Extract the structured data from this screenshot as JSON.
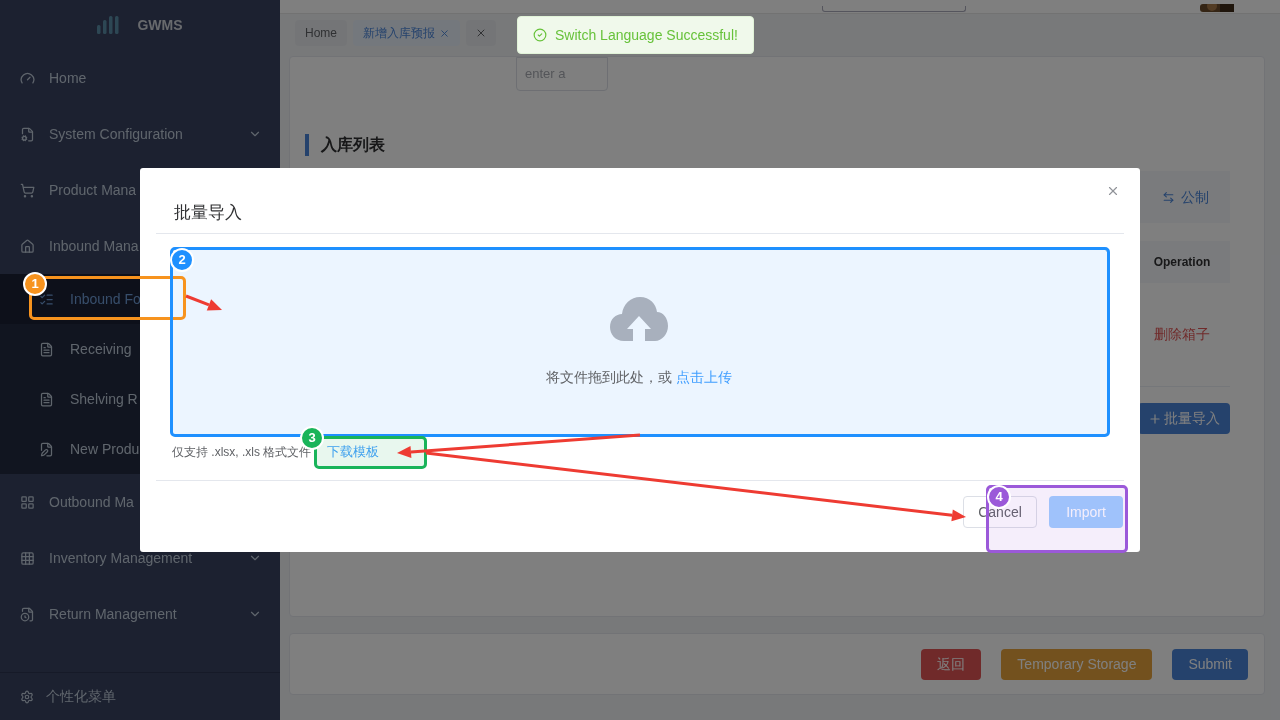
{
  "sidebar": {
    "logo": "GWMS",
    "items": [
      {
        "label": "Home",
        "kind": "link"
      },
      {
        "label": "System Configuration",
        "kind": "menu"
      },
      {
        "label": "Product Mana",
        "kind": "link"
      },
      {
        "label": "Inbound Mana",
        "kind": "link",
        "children": [
          {
            "label": "Inbound Fo",
            "selected": true
          },
          {
            "label": "Receiving",
            "selected": false
          },
          {
            "label": "Shelving R",
            "selected": false
          },
          {
            "label": "New Produ",
            "selected": false
          }
        ]
      },
      {
        "label": "Outbound Ma",
        "kind": "link"
      },
      {
        "label": "Inventory Management",
        "kind": "menu"
      },
      {
        "label": "Return Management",
        "kind": "menu"
      }
    ],
    "footer": "个性化菜单"
  },
  "tabs": [
    {
      "label": "Home",
      "selected": false,
      "closable": false
    },
    {
      "label": "新增入库预报",
      "selected": true,
      "closable": true
    }
  ],
  "toast": {
    "message": "Switch Language Successful!"
  },
  "form": {
    "remarks_placeholder": "enter a"
  },
  "section_title": "入库列表",
  "unit_switch": "公制",
  "table": {
    "operation_header": "Operation",
    "row_action": "删除箱子"
  },
  "batch_import_button": "批量导入",
  "footer_buttons": [
    {
      "label": "返回",
      "kind": "danger"
    },
    {
      "label": "Temporary Storage",
      "kind": "warning"
    },
    {
      "label": "Submit",
      "kind": "primary"
    }
  ],
  "dialog": {
    "title": "批量导入",
    "drop_text": "将文件拖到此处，或",
    "drop_link": "点击上传",
    "hint": "仅支持 .xlsx, .xls 格式文件",
    "template_link": "下载模板",
    "buttons": [
      {
        "label": "Cancel",
        "kind": "default",
        "disabled": false
      },
      {
        "label": "Import",
        "kind": "primary",
        "disabled": true
      }
    ]
  },
  "annotations": [
    {
      "number": "1",
      "color": "#f7931e"
    },
    {
      "number": "2",
      "color": "#1e90ff"
    },
    {
      "number": "3",
      "color": "#19b45a"
    },
    {
      "number": "4",
      "color": "#9b59d9"
    }
  ]
}
